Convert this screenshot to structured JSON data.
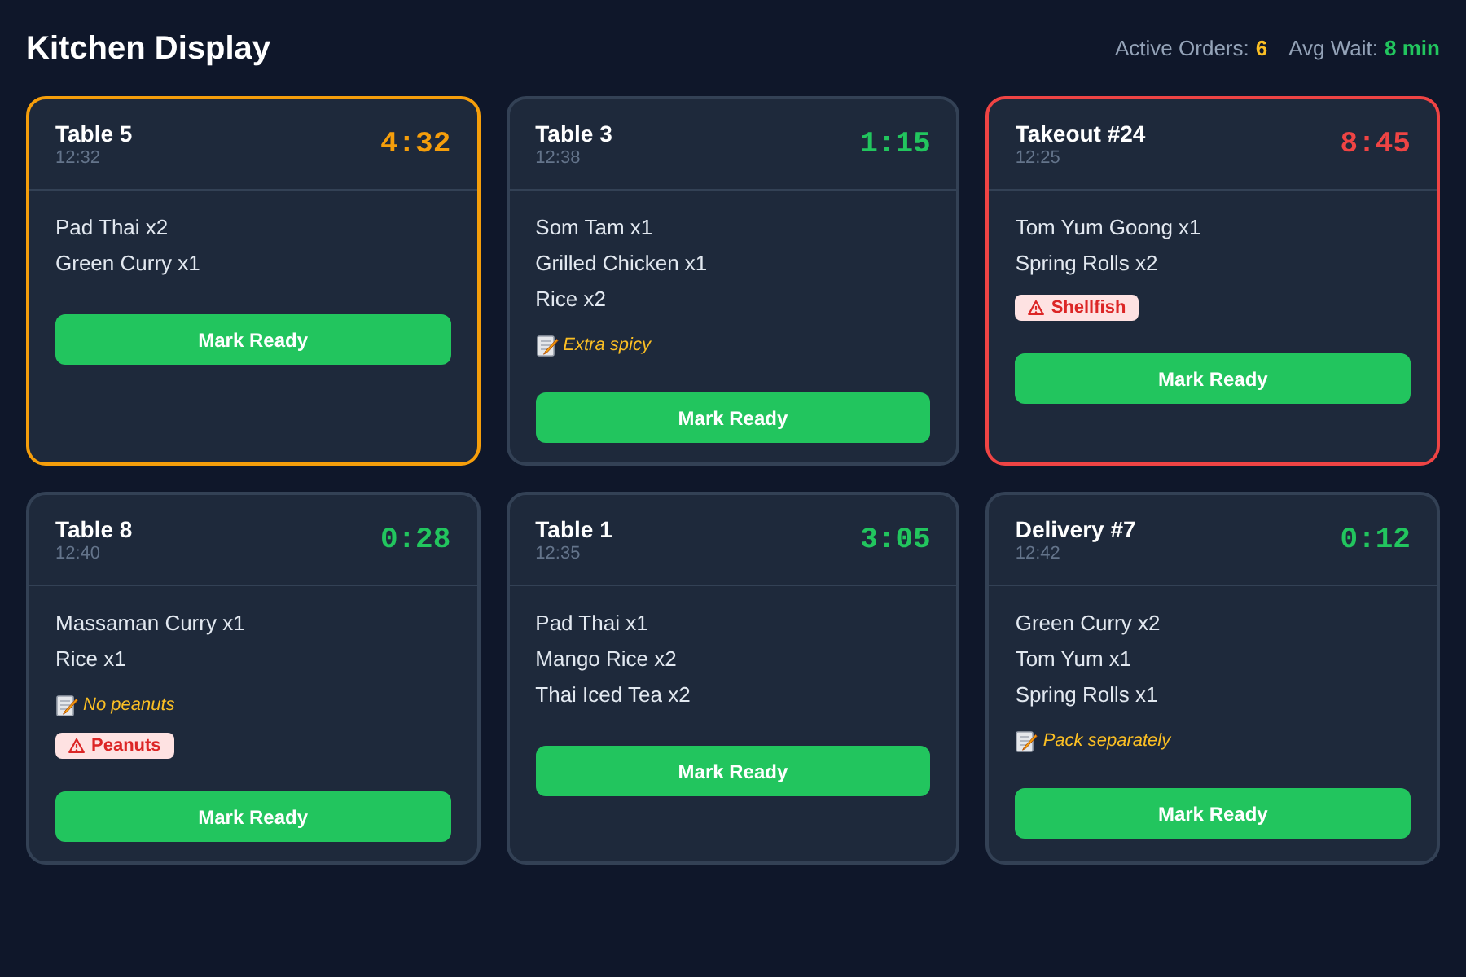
{
  "header": {
    "title": "Kitchen Display",
    "stats": [
      {
        "label": "Active Orders:",
        "value": "6",
        "color": "#fbbf24"
      },
      {
        "label": "Avg Wait:",
        "value": "8 min",
        "color": "#22c55e"
      }
    ]
  },
  "orders": [
    {
      "name": "Table 5",
      "time": "12:32",
      "timer": "4:32",
      "color": "#f59e0b",
      "highlighted": true,
      "items": [
        "Pad Thai x2",
        "Green Curry x1"
      ],
      "button": "Mark Ready"
    },
    {
      "name": "Table 3",
      "time": "12:38",
      "timer": "1:15",
      "color": "#22c55e",
      "highlighted": false,
      "items": [
        "Som Tam x1",
        "Grilled Chicken x1",
        "Rice x2"
      ],
      "note": "Extra spicy",
      "button": "Mark Ready"
    },
    {
      "name": "Takeout #24",
      "time": "12:25",
      "timer": "8:45",
      "color": "#ef4444",
      "highlighted": true,
      "items": [
        "Tom Yum Goong x1",
        "Spring Rolls x2"
      ],
      "allergens": [
        "Shellfish"
      ],
      "button": "Mark Ready"
    },
    {
      "name": "Table 8",
      "time": "12:40",
      "timer": "0:28",
      "color": "#22c55e",
      "highlighted": false,
      "items": [
        "Massaman Curry x1",
        "Rice x1"
      ],
      "note": "No peanuts",
      "allergens": [
        "Peanuts"
      ],
      "button": "Mark Ready"
    },
    {
      "name": "Table 1",
      "time": "12:35",
      "timer": "3:05",
      "color": "#22c55e",
      "highlighted": false,
      "items": [
        "Pad Thai x1",
        "Mango Rice x2",
        "Thai Iced Tea x2"
      ],
      "button": "Mark Ready"
    },
    {
      "name": "Delivery #7",
      "time": "12:42",
      "timer": "0:12",
      "color": "#22c55e",
      "highlighted": false,
      "items": [
        "Green Curry x2",
        "Tom Yum x1",
        "Spring Rolls x1"
      ],
      "note": "Pack separately",
      "button": "Mark Ready"
    }
  ]
}
